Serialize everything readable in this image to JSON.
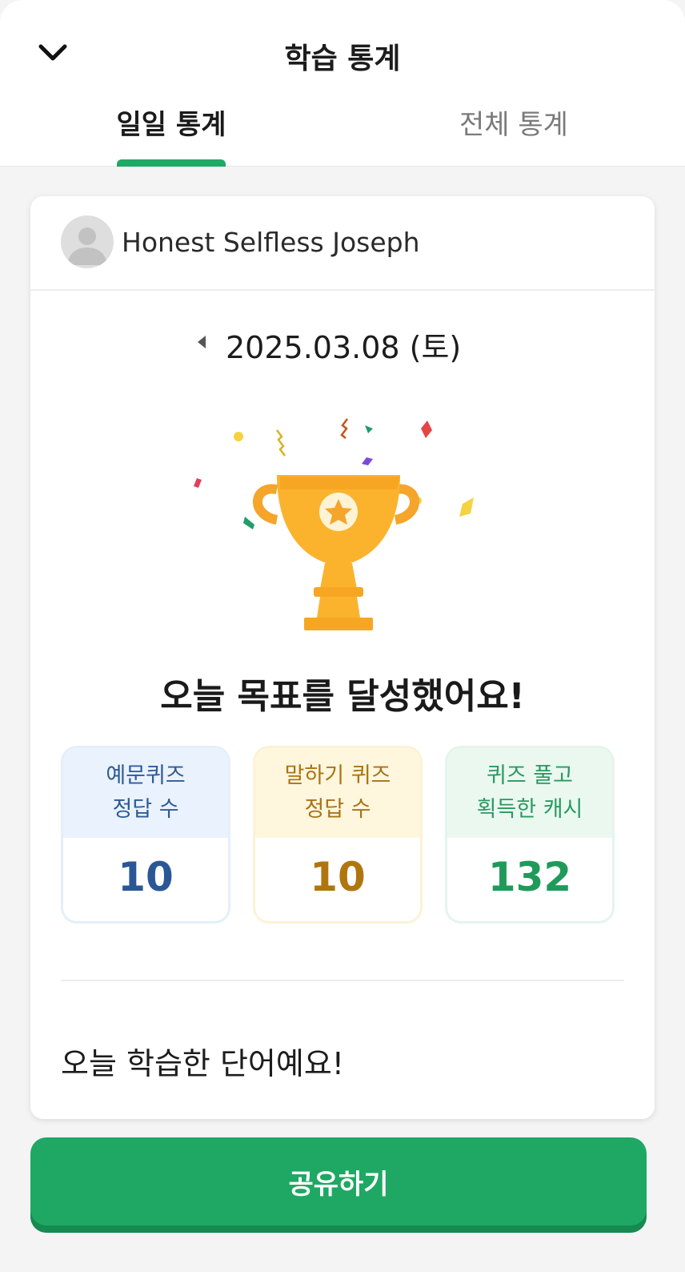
{
  "header": {
    "title": "학습 통계",
    "back_icon": "chevron-down-icon"
  },
  "tabs": [
    {
      "label": "일일 통계",
      "selected": true
    },
    {
      "label": "전체 통계",
      "selected": false
    }
  ],
  "profile": {
    "name": "Honest Selfless Joseph",
    "avatar_icon": "user-avatar-icon"
  },
  "date": {
    "text": "2025.03.08 (토)",
    "prev_icon": "caret-left-icon"
  },
  "illustration": "trophy-icon",
  "goal_message": "오늘 목표를 달성했어요!",
  "stats": [
    {
      "line1": "예문퀴즈",
      "line2": "정답 수",
      "value": "10",
      "color": "#2a5896"
    },
    {
      "line1": "말하기 퀴즈",
      "line2": "정답 수",
      "value": "10",
      "color": "#b0760e"
    },
    {
      "line1": "퀴즈 풀고",
      "line2": "획득한 캐시",
      "value": "132",
      "color": "#209a5a"
    }
  ],
  "words_section_title": "오늘 학습한 단어예요!",
  "share_button_label": "공유하기",
  "colors": {
    "accent": "#1ea864"
  }
}
